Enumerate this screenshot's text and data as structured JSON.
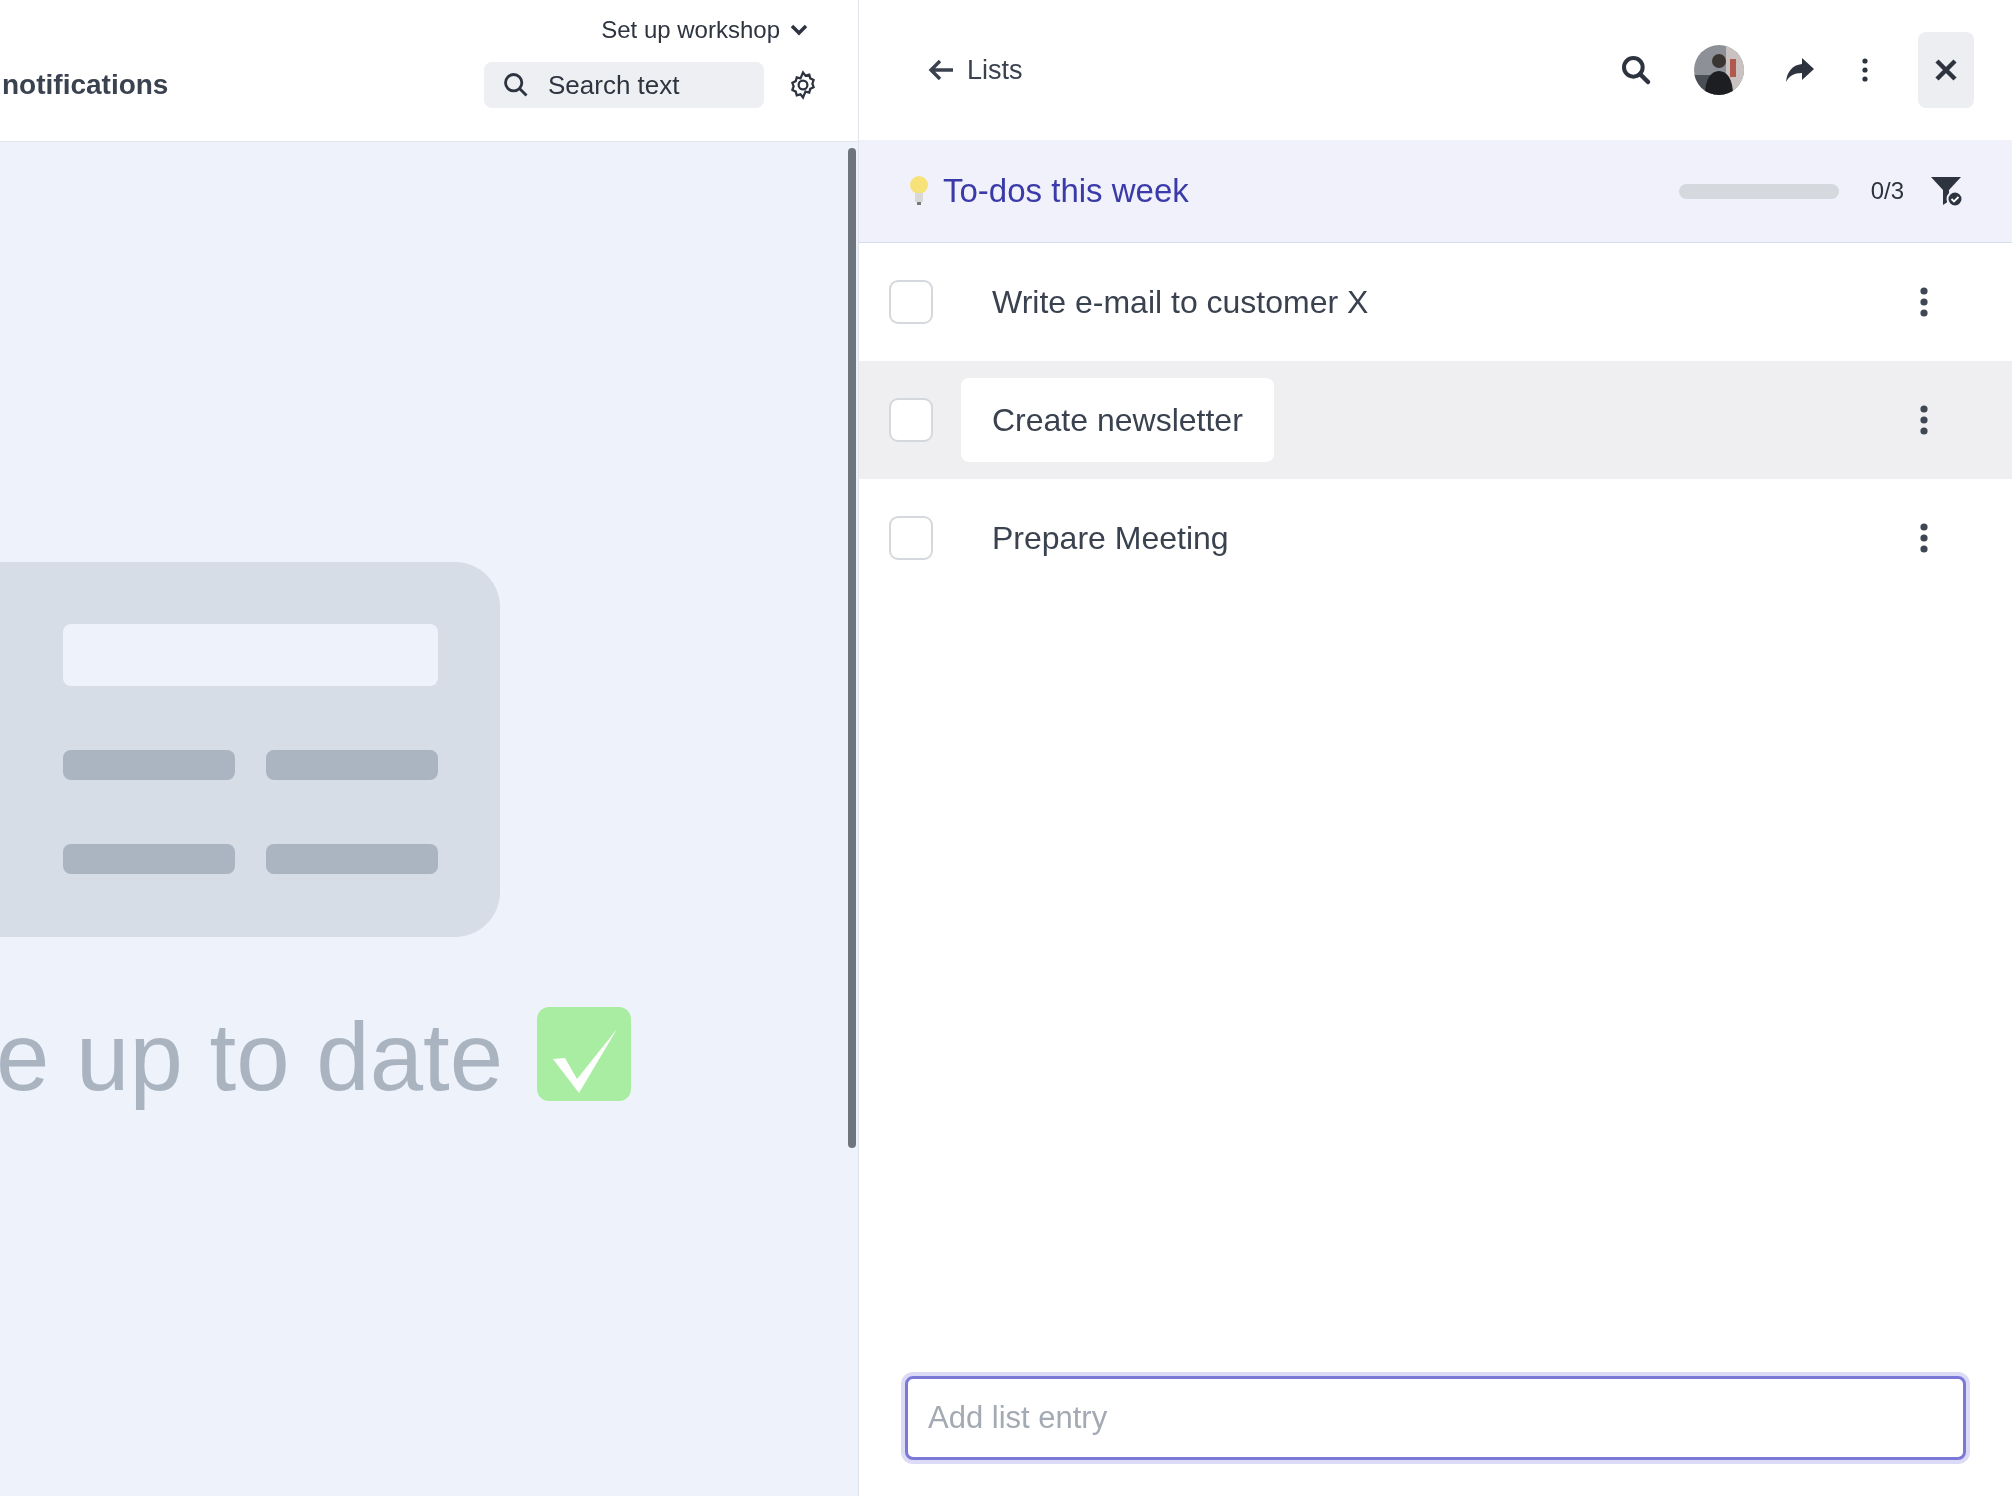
{
  "left_panel": {
    "workspace_menu": "Set up workshop",
    "page_title": "notifications",
    "search": {
      "placeholder": "Search text"
    },
    "empty_state": {
      "message": "e up to date"
    }
  },
  "list_panel": {
    "back_link": "Lists",
    "list": {
      "title": "To-dos this week",
      "progress": {
        "level": 0
      },
      "count": "0/3"
    },
    "items": [
      {
        "text": "Write e-mail to customer X",
        "checked": false,
        "highlighted": false
      },
      {
        "text": "Create newsletter",
        "checked": false,
        "highlighted": true
      },
      {
        "text": "Prepare Meeting",
        "checked": false,
        "highlighted": false
      }
    ],
    "new_entry": {
      "placeholder": "Add list entry"
    }
  }
}
